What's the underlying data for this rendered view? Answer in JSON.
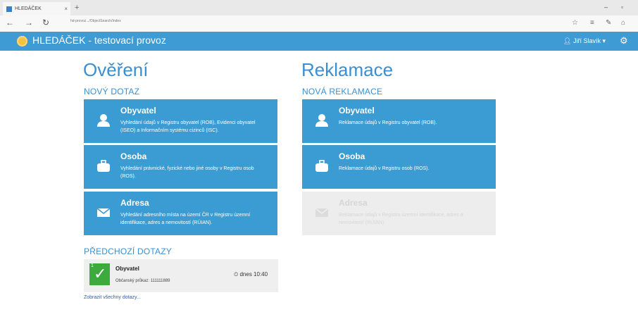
{
  "browser": {
    "tab_title": "HLEDÁČEK",
    "tab_close": "×",
    "new_tab": "+",
    "url": "hd-provoz.../ObjectSearch/Index",
    "win_min": "–",
    "win_max": "▫",
    "nav_back": "←",
    "nav_fwd": "→",
    "nav_reload": "↻",
    "star": "☆",
    "menu": "≡",
    "edit": "✎",
    "share": "⌂"
  },
  "app": {
    "title": "HLEDÁČEK - testovací provoz",
    "user": "Jiří Slavík",
    "user_caret": "▾",
    "settings": "⚙"
  },
  "left": {
    "heading": "Ověření",
    "subheading": "NOVÝ DOTAZ",
    "tiles": [
      {
        "title": "Obyvatel",
        "desc": "Vyhledání údajů v Registru obyvatel (ROB), Evidenci obyvatel (ISEO) a Informačním systému cizinců (ISC)."
      },
      {
        "title": "Osoba",
        "desc": "Vyhledání právnické, fyzické nebo jiné osoby v Registru osob (ROS)."
      },
      {
        "title": "Adresa",
        "desc": "Vyhledání adresního místa na území ČR v Registru územní identifikace, adres a nemovitostí (RÚIAN)."
      }
    ],
    "previous_heading": "PŘEDCHOZÍ DOTAZY",
    "previous": {
      "count": "1",
      "title": "Obyvatel",
      "sub": "Občanský průkaz: 111111889",
      "time": "dnes 10:40"
    },
    "show_all": "Zobrazit všechny dotazy..."
  },
  "right": {
    "heading": "Reklamace",
    "subheading": "NOVÁ REKLAMACE",
    "tiles": [
      {
        "title": "Obyvatel",
        "desc": "Reklamace údajů v Registru obyvatel (ROB)."
      },
      {
        "title": "Osoba",
        "desc": "Reklamace údajů v Registru osob (ROS)."
      },
      {
        "title": "Adresa",
        "desc": "Reklamace údajů v Registru územní identifikace, adres a nemovitostí (RÚIAN)."
      }
    ]
  }
}
